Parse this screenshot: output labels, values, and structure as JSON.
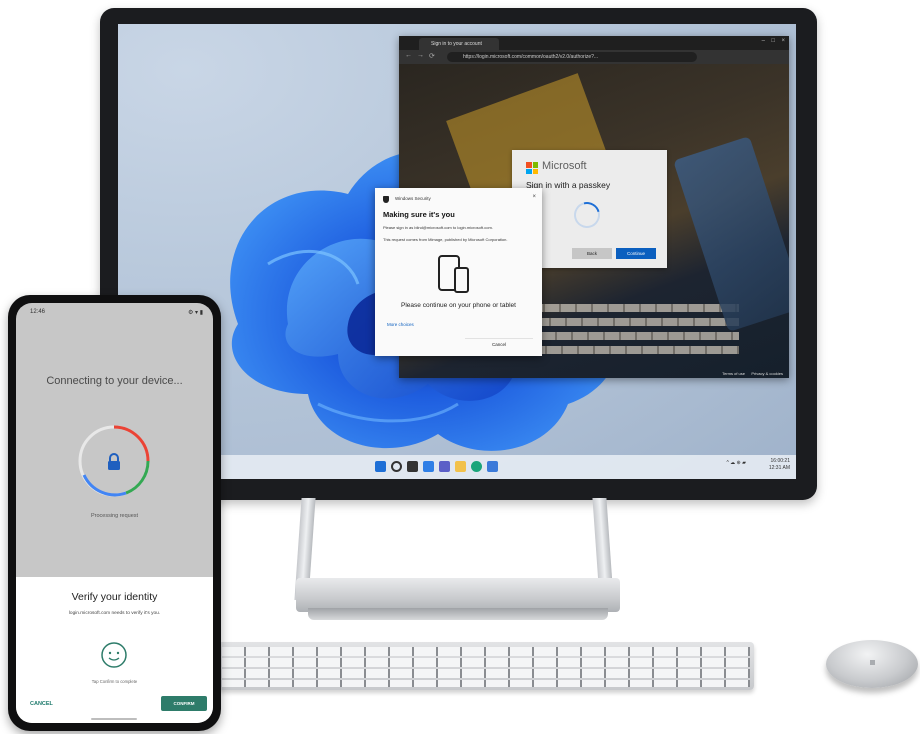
{
  "browser": {
    "tab_title": "Sign in to your account",
    "url": "https://login.microsoft.com/common/oauth2/v2.0/authorize?...",
    "footer": {
      "terms": "Terms of use",
      "privacy": "Privacy & cookies"
    }
  },
  "ms_card": {
    "brand": "Microsoft",
    "heading": "Sign in with a passkey",
    "back_label": "Back",
    "continue_label": "Continue",
    "logo_colors": [
      "#f25022",
      "#7fba00",
      "#00a4ef",
      "#ffb900"
    ]
  },
  "windows_security": {
    "app_title": "Windows Security",
    "title": "Making sure it's you",
    "line1": "Please sign in as blind@microsoft.com to login.microsoft.com.",
    "line2": "This request comes from Mimage, published by Microsoft Corporation.",
    "confirm_text": "Please continue on your phone or tablet",
    "more_choices": "More choices",
    "cancel_label": "Cancel"
  },
  "taskbar": {
    "icons": [
      "windows-icon",
      "search-icon",
      "taskview-icon",
      "widgets-icon",
      "chat-icon",
      "explorer-icon",
      "edge-icon",
      "store-icon"
    ],
    "tray": "^ ☁ ⊕ ▰",
    "clock_time": "16:00:21",
    "clock_date": "12:31 AM"
  },
  "phone": {
    "status_time": "12:46",
    "status_icons": "⚙ ▾ ▮",
    "connecting": "Connecting to your device...",
    "processing": "Processing request",
    "sheet": {
      "title": "Verify your identity",
      "subtitle": "login.microsoft.com needs to verify it's you.",
      "tap_text": "Tap Confirm to complete",
      "cancel_label": "CANCEL",
      "confirm_label": "CONFIRM"
    }
  },
  "colors": {
    "accent_blue": "#0b5fbf",
    "phone_green": "#2e7c6a",
    "wallpaper_blue": "#1f5fe0"
  }
}
